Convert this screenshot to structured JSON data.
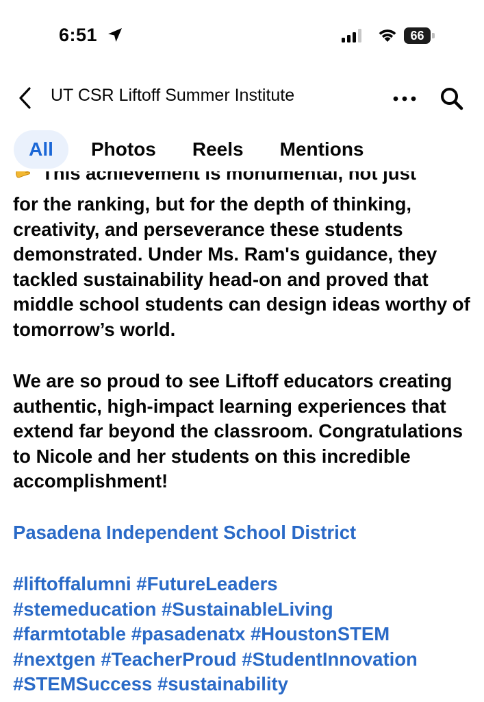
{
  "status_bar": {
    "time": "6:51",
    "battery_level": "66"
  },
  "header": {
    "title": "UT CSR Liftoff Summer Institute"
  },
  "tabs": [
    {
      "label": "All",
      "active": true
    },
    {
      "label": "Photos",
      "active": false
    },
    {
      "label": "Reels",
      "active": false
    },
    {
      "label": "Mentions",
      "active": false
    }
  ],
  "post": {
    "clipped_line": "This achievement is monumental, not just",
    "paragraph_1": "for the ranking, but for the depth of thinking, creativity, and perseverance these students demonstrated. Under Ms. Ram's guidance, they tackled sustainability head-on and proved that middle school students can design ideas worthy of tomorrow’s world.",
    "paragraph_2": "We are so proud to see Liftoff educators creating authentic, high-impact learning experiences that extend far beyond the classroom. Congratulations to Nicole and her students on this incredible accomplishment!",
    "mention": "Pasadena Independent School District",
    "hashtags": [
      "#liftoffalumni",
      "#FutureLeaders",
      "#stemeducation",
      "#SustainableLiving",
      "#farmtotable",
      "#pasadenatx",
      "#HoustonSTEM",
      "#nextgen",
      "#TeacherProud",
      "#StudentInnovation",
      "#STEMSuccess",
      "#sustainability"
    ]
  },
  "colors": {
    "link": "#2a6ac7",
    "active_tab_bg": "#eaf1fc",
    "active_tab_text": "#1b67d6"
  }
}
